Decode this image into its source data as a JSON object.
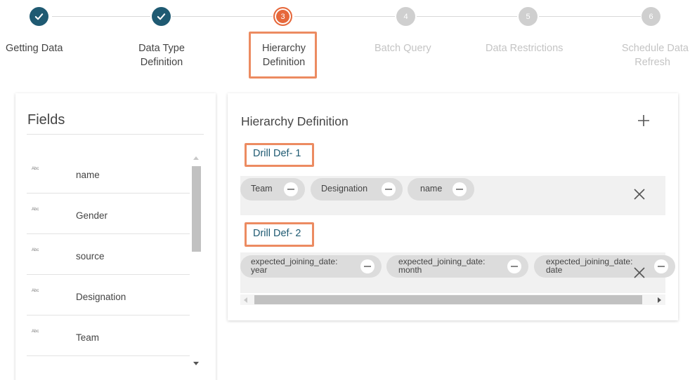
{
  "stepper": {
    "steps": [
      {
        "number": "1",
        "label": "Getting Data",
        "status": "completed"
      },
      {
        "number": "2",
        "label": "Data Type Definition",
        "label_line1": "Data Type",
        "label_line2": "Definition",
        "status": "completed"
      },
      {
        "number": "3",
        "label": "Hierarchy Definition",
        "label_line1": "Hierarchy",
        "label_line2": "Definition",
        "status": "active"
      },
      {
        "number": "4",
        "label": "Batch Query",
        "status": "pending"
      },
      {
        "number": "5",
        "label": "Data Restrictions",
        "status": "pending"
      },
      {
        "number": "6",
        "label": "Schedule Data Refresh",
        "label_line1": "Schedule Data",
        "label_line2": "Refresh",
        "status": "pending"
      }
    ]
  },
  "fields": {
    "title": "Fields",
    "items": [
      {
        "type": "Abc",
        "name": "name"
      },
      {
        "type": "Abc",
        "name": "Gender"
      },
      {
        "type": "Abc",
        "name": "source"
      },
      {
        "type": "Abc",
        "name": "Designation"
      },
      {
        "type": "Abc",
        "name": "Team"
      }
    ]
  },
  "hierarchy": {
    "title": "Hierarchy Definition",
    "add_icon": "plus-icon",
    "drills": [
      {
        "title": "Drill Def- 1",
        "chips": [
          {
            "label": "Team"
          },
          {
            "label": "Designation"
          },
          {
            "label": "name"
          }
        ]
      },
      {
        "title": "Drill Def- 2",
        "chips": [
          {
            "line1": "expected_joining_date:",
            "line2": "year"
          },
          {
            "line1": "expected_joining_date:",
            "line2": "month"
          },
          {
            "line1": "expected_joining_date:",
            "line2": "date"
          }
        ]
      }
    ]
  },
  "colors": {
    "accent": "#1f5a72",
    "active_step": "#e6683b",
    "highlight_box": "#ec8b61",
    "pending_step": "#cfcfcf"
  }
}
